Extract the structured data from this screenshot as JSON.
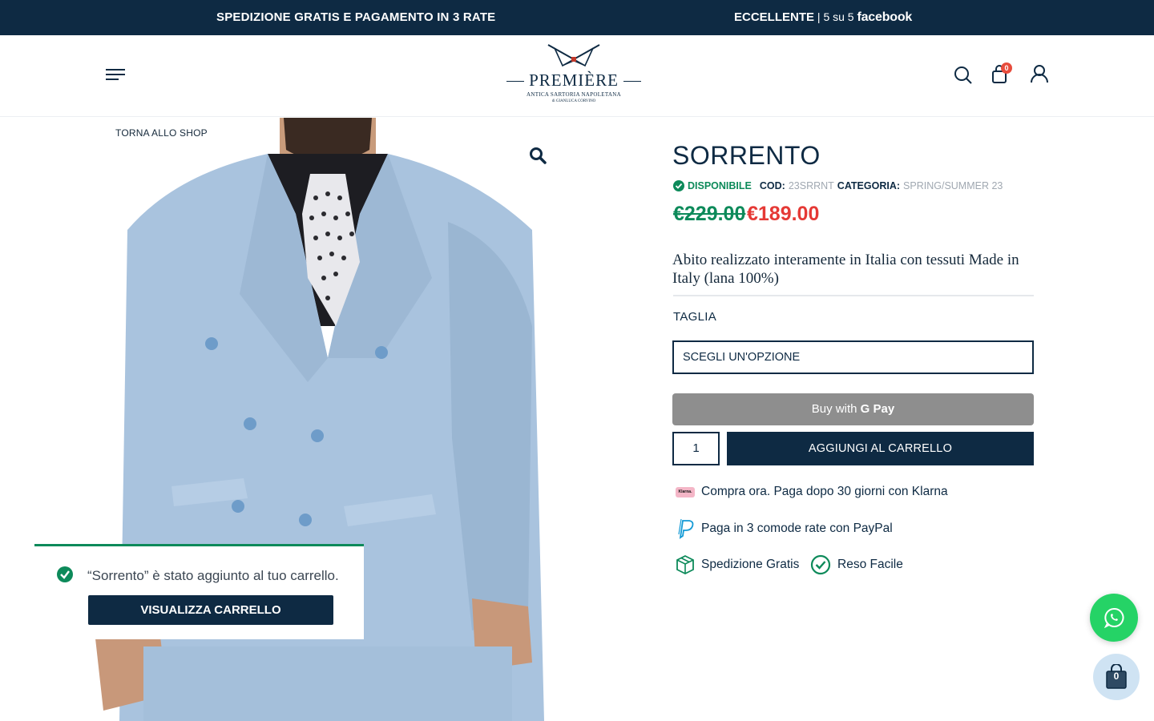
{
  "topbar": {
    "promo": "SPEDIZIONE GRATIS E PAGAMENTO IN 3 RATE",
    "rating_label": "ECCELLENTE",
    "rating_sep": " | ",
    "rating_value": "5 su 5 ",
    "rating_source": "facebook"
  },
  "header": {
    "logo_brand": "PREMIÈRE",
    "logo_sub1": "ANTICA SARTORIA NAPOLETANA",
    "logo_sub2": "di GIANLUCA CORVINO",
    "cart_count": "0"
  },
  "gallery": {
    "back_link": "TORNA ALLO SHOP",
    "zoom_icon": "magnifier-icon"
  },
  "notice": {
    "message": "“Sorrento” è stato aggiunto al tuo carrello.",
    "button": "VISUALIZZA CARRELLO"
  },
  "product": {
    "title": "SORRENTO",
    "availability": "DISPONIBILE",
    "sku_label": "COD:",
    "sku_value": "23SRRNT",
    "category_label": "CATEGORIA:",
    "category_value": "SPRING/SUMMER 23",
    "price_old": "€229.00",
    "price_new": "€189.00",
    "description": "Abito realizzato interamente in Italia con tessuti Made in Italy (lana 100%)",
    "size_label": "TAGLIA",
    "size_select": "SCEGLI UN'OPZIONE",
    "gpay_prefix": "Buy with ",
    "gpay_brand": "G Pay",
    "quantity": "1",
    "add_to_cart": "AGGIUNGI AL CARRELLO"
  },
  "perks": {
    "klarna_badge": "Klarna.",
    "klarna": "Compra ora. Paga dopo 30 giorni con Klarna",
    "paypal": "Paga in 3 comode rate con PayPal",
    "shipping": "Spedizione Gratis",
    "returns": "Reso Facile"
  },
  "floating": {
    "cart_count": "0"
  },
  "colors": {
    "navy": "#0e2a43",
    "green": "#0d8a5a",
    "sale_red": "#e53935",
    "whatsapp": "#25d366"
  }
}
